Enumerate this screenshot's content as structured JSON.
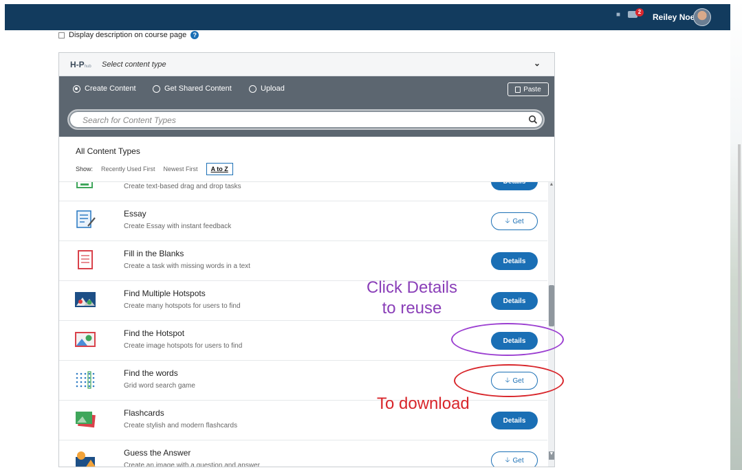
{
  "topbar": {
    "notification_count": "2",
    "user_name": "Reiley Noe"
  },
  "description_checkbox": {
    "label": "Display description on course page",
    "checked": false
  },
  "hub": {
    "logo": "H-P",
    "logo_sub": "hub",
    "select_label": "Select content type",
    "tabs": [
      {
        "label": "Create Content",
        "selected": true
      },
      {
        "label": "Get Shared Content",
        "selected": false
      },
      {
        "label": "Upload",
        "selected": false
      }
    ],
    "paste_label": "Paste",
    "search_placeholder": "Search for Content Types",
    "filter_title": "All Content Types",
    "show_label": "Show:",
    "sort_options": [
      "Recently Used First",
      "Newest First",
      "A to Z"
    ],
    "active_sort": "A to Z"
  },
  "content_types": [
    {
      "title": "",
      "desc": "Create text-based drag and drop tasks",
      "action": "Details",
      "icon": "drag-text-icon"
    },
    {
      "title": "Essay",
      "desc": "Create Essay with instant feedback",
      "action": "Get",
      "icon": "essay-icon"
    },
    {
      "title": "Fill in the Blanks",
      "desc": "Create a task with missing words in a text",
      "action": "Details",
      "icon": "fill-blanks-icon"
    },
    {
      "title": "Find Multiple Hotspots",
      "desc": "Create many hotspots for users to find",
      "action": "Details",
      "icon": "multiple-hotspots-icon"
    },
    {
      "title": "Find the Hotspot",
      "desc": "Create image hotspots for users to find",
      "action": "Details",
      "icon": "hotspot-icon"
    },
    {
      "title": "Find the words",
      "desc": "Grid word search game",
      "action": "Get",
      "icon": "word-grid-icon"
    },
    {
      "title": "Flashcards",
      "desc": "Create stylish and modern flashcards",
      "action": "Details",
      "icon": "flashcards-icon"
    },
    {
      "title": "Guess the Answer",
      "desc": "Create an image with a question and answer",
      "action": "Get",
      "icon": "guess-answer-icon"
    }
  ],
  "annotations": {
    "details_line1": "Click Details",
    "details_line2": "to reuse",
    "download": "To download",
    "details_color": "#8a3fb8",
    "download_color": "#d8262b"
  },
  "colors": {
    "topbar": "#123b5e",
    "button_blue": "#1a6fb5",
    "hub_bar": "#5c6670"
  }
}
